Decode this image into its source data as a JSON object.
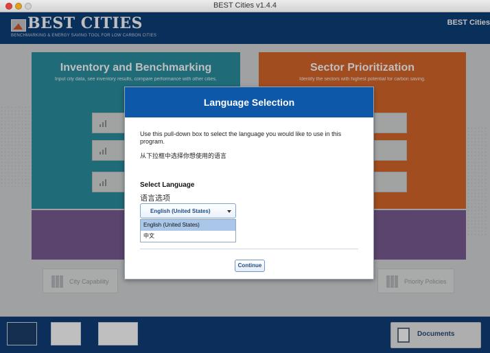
{
  "window": {
    "title": "BEST Cities v1.4.4"
  },
  "header": {
    "brand": "BEST CITIES",
    "tagline": "BENCHMARKING & ENERGY SAVING TOOL FOR LOW CARBON CITIES",
    "right_label": "BEST Cities"
  },
  "panels": {
    "inventory": {
      "title": "Inventory and Benchmarking",
      "subtitle": "Input city data, see inventory results, compare performance with other cities."
    },
    "sector": {
      "title": "Sector Prioritization",
      "subtitle": "Identify the sectors with highest potential for carbon saving."
    }
  },
  "bottom_row": {
    "city_capability": "City Capability",
    "priority_policies": "Priority Policies"
  },
  "footer": {
    "documents_label": "Documents"
  },
  "dialog": {
    "title": "Language Selection",
    "instruction_en": "Use this pull-down box to select the language you would like to use in this program.",
    "instruction_zh": "从下拉框中选择你想使用的语言",
    "select_label": "Select Language",
    "select_label_zh": "语言选项",
    "selected_value": "English (United States)",
    "options": [
      "English (United States)",
      "中文"
    ],
    "continue_label": "Continue"
  },
  "colors": {
    "header_blue": "#0d3f7a",
    "dialog_header_blue": "#0d58a8",
    "teal_panel": "#2a8fa1",
    "orange_panel": "#d8672b",
    "purple_panel": "#7a5b92",
    "selected_option": "#aac7ea"
  }
}
